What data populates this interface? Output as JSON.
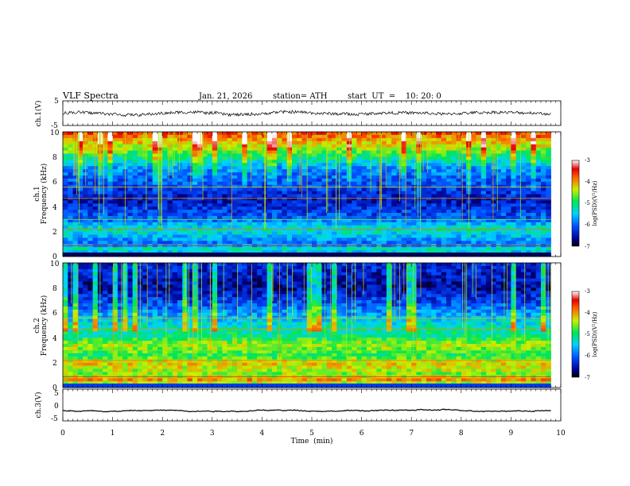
{
  "header": {
    "title": "VLF  Spectra",
    "date": "Jan. 21, 2026",
    "station": "station= ATH",
    "start_ut": "start  UT  =    10: 20: 0"
  },
  "chart_data": [
    {
      "type": "line",
      "id": "ch1-waveform",
      "ylabel": "ch.1(V)",
      "yticks": [
        "5",
        "-5"
      ],
      "ylim": [
        -5,
        5
      ],
      "xlim": [
        0,
        10
      ],
      "x_end": 9.8,
      "approx_mean": 0,
      "approx_amplitude": 1.2,
      "color": "#000000"
    },
    {
      "type": "heatmap",
      "id": "ch1-spectrogram",
      "ylabel": "ch.1\nFrequency  (kHz)",
      "yticks": [
        "10",
        "8",
        "6",
        "4",
        "2",
        "0"
      ],
      "ylim": [
        0,
        10
      ],
      "xlim": [
        0,
        10
      ],
      "x_end": 9.8,
      "colorbar": {
        "label": "log(PSD)(V²/Hz)",
        "ticks": [
          "-3",
          "-4",
          "-5",
          "-6",
          "-7"
        ],
        "range": [
          -7,
          -3
        ]
      },
      "approx_log_psd_profile": [
        {
          "freq_khz": 10,
          "value": -3.6
        },
        {
          "freq_khz": 8.5,
          "value": -4.6
        },
        {
          "freq_khz": 7,
          "value": -5.8
        },
        {
          "freq_khz": 5.5,
          "value": -6.2
        },
        {
          "freq_khz": 4.5,
          "value": -6.5
        },
        {
          "freq_khz": 3,
          "value": -6.0
        },
        {
          "freq_khz": 2.2,
          "value": -5.2
        },
        {
          "freq_khz": 1,
          "value": -6.0
        },
        {
          "freq_khz": 0.5,
          "value": -5.0
        },
        {
          "freq_khz": 0,
          "value": -6.8
        }
      ]
    },
    {
      "type": "heatmap",
      "id": "ch2-spectrogram",
      "ylabel": "ch.2\nFrequency  (kHz)",
      "yticks": [
        "10",
        "8",
        "6",
        "4",
        "2",
        "0"
      ],
      "ylim": [
        0,
        10
      ],
      "xlim": [
        0,
        10
      ],
      "x_end": 9.8,
      "colorbar": {
        "label": "log(PSD)(V²/Hz)",
        "ticks": [
          "-3",
          "-4",
          "-5",
          "-6",
          "-7"
        ],
        "range": [
          -7,
          -3
        ]
      },
      "approx_log_psd_profile": [
        {
          "freq_khz": 10,
          "value": -6.3
        },
        {
          "freq_khz": 8,
          "value": -6.6
        },
        {
          "freq_khz": 6.5,
          "value": -6.0
        },
        {
          "freq_khz": 5,
          "value": -5.3
        },
        {
          "freq_khz": 4,
          "value": -5.0
        },
        {
          "freq_khz": 3.5,
          "value": -4.4
        },
        {
          "freq_khz": 2.5,
          "value": -4.9
        },
        {
          "freq_khz": 2,
          "value": -4.2
        },
        {
          "freq_khz": 1,
          "value": -4.6
        },
        {
          "freq_khz": 0.5,
          "value": -3.8
        },
        {
          "freq_khz": 0,
          "value": -6.2
        }
      ]
    },
    {
      "type": "line",
      "id": "ch3-waveform",
      "ylabel": "ch.3(V)",
      "yticks": [
        "5",
        "0",
        "-5"
      ],
      "ylim": [
        -5,
        5
      ],
      "xlim": [
        0,
        10
      ],
      "x_end": 9.8,
      "approx_mean": -1.7,
      "approx_amplitude": 0.2,
      "color": "#000000"
    }
  ],
  "x_axis": {
    "label": "Time  (min)",
    "ticks": [
      "0",
      "1",
      "2",
      "3",
      "4",
      "5",
      "6",
      "7",
      "8",
      "9",
      "10"
    ]
  }
}
